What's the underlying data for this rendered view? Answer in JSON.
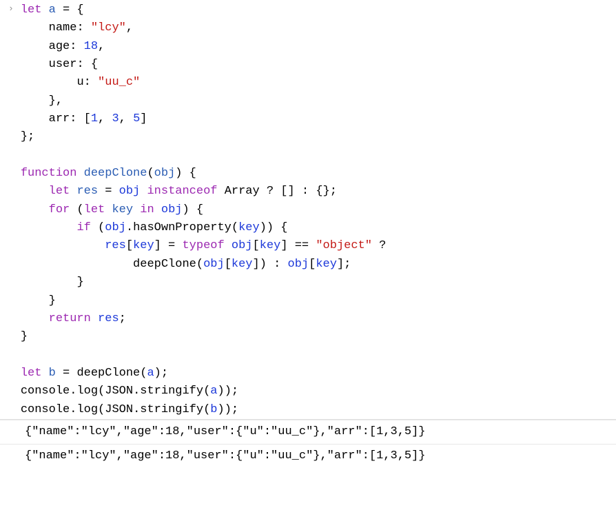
{
  "prompt": "›",
  "code": {
    "l1_let": "let",
    "l1_a": "a",
    "l1_eq": " = {",
    "l2_name": "name",
    "l2_colon": ": ",
    "l2_val": "\"lcy\"",
    "l2_comma": ",",
    "l3_age": "age",
    "l3_colon": ": ",
    "l3_val": "18",
    "l3_comma": ",",
    "l4_user": "user",
    "l4_colon": ": {",
    "l5_u": "u",
    "l5_colon": ": ",
    "l5_val": "\"uu_c\"",
    "l6_close": "},",
    "l7_arr": "arr",
    "l7_colon": ": [",
    "l7_v1": "1",
    "l7_s1": ", ",
    "l7_v2": "3",
    "l7_s2": ", ",
    "l7_v3": "5",
    "l7_close": "]",
    "l8_close": "};",
    "l10_function": "function",
    "l10_name": "deepClone",
    "l10_open": "(",
    "l10_obj": "obj",
    "l10_close": ") {",
    "l11_let": "let",
    "l11_res": "res",
    "l11_eq": " = ",
    "l11_obj": "obj",
    "l11_instanceof": " instanceof ",
    "l11_array": "Array",
    "l11_tern": " ? [] : {};",
    "l12_for": "for",
    "l12_open": " (",
    "l12_let": "let",
    "l12_key": " key",
    "l12_in": " in ",
    "l12_obj": "obj",
    "l12_close": ") {",
    "l13_if": "if",
    "l13_open": " (",
    "l13_obj": "obj",
    "l13_dot": ".",
    "l13_has": "hasOwnProperty",
    "l13_p1": "(",
    "l13_key": "key",
    "l13_p2": ")) {",
    "l14_res": "res",
    "l14_b1": "[",
    "l14_key": "key",
    "l14_b2": "] = ",
    "l14_typeof": "typeof",
    "l14_sp": " ",
    "l14_obj": "obj",
    "l14_b3": "[",
    "l14_key2": "key",
    "l14_b4": "] == ",
    "l14_str": "\"object\"",
    "l14_q": " ?",
    "l15_dc": "deepClone",
    "l15_p1": "(",
    "l15_obj": "obj",
    "l15_b1": "[",
    "l15_key": "key",
    "l15_b2": "]) : ",
    "l15_obj2": "obj",
    "l15_b3": "[",
    "l15_key2": "key",
    "l15_b4": "];",
    "l16_close": "}",
    "l17_close": "}",
    "l18_return": "return",
    "l18_res": " res",
    "l18_semi": ";",
    "l19_close": "}",
    "l21_let": "let",
    "l21_b": " b",
    "l21_eq": " = ",
    "l21_dc": "deepClone",
    "l21_p1": "(",
    "l21_a": "a",
    "l21_p2": ");",
    "l22_console": "console",
    "l22_dot": ".",
    "l22_log": "log",
    "l22_p1": "(",
    "l22_json": "JSON",
    "l22_dot2": ".",
    "l22_str": "stringify",
    "l22_p2": "(",
    "l22_a": "a",
    "l22_p3": "));",
    "l23_console": "console",
    "l23_dot": ".",
    "l23_log": "log",
    "l23_p1": "(",
    "l23_json": "JSON",
    "l23_dot2": ".",
    "l23_str": "stringify",
    "l23_p2": "(",
    "l23_b": "b",
    "l23_p3": "));"
  },
  "output": {
    "line1": "{\"name\":\"lcy\",\"age\":18,\"user\":{\"u\":\"uu_c\"},\"arr\":[1,3,5]}",
    "line2": "{\"name\":\"lcy\",\"age\":18,\"user\":{\"u\":\"uu_c\"},\"arr\":[1,3,5]}"
  },
  "watermark": ""
}
